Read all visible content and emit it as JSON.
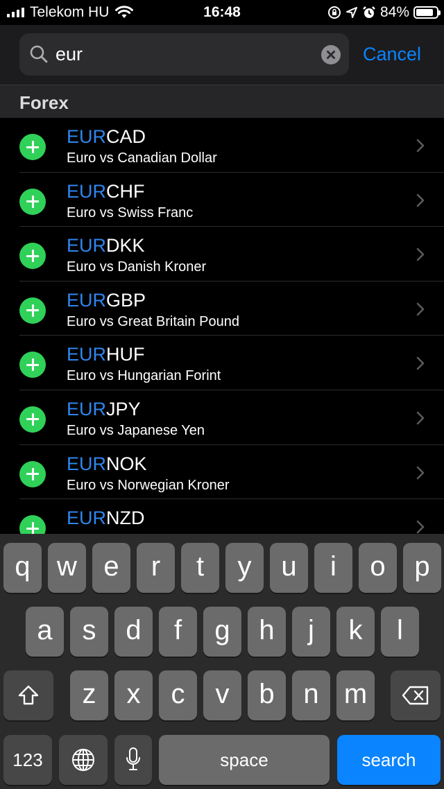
{
  "status_bar": {
    "carrier": "Telekom HU",
    "time": "16:48",
    "battery": "84%",
    "battery_level": 0.84,
    "icons": [
      "signal-icon",
      "wifi-icon",
      "orientation-lock-icon",
      "location-icon",
      "alarm-icon",
      "battery-icon"
    ]
  },
  "search": {
    "query": "eur",
    "cancel_label": "Cancel"
  },
  "section": {
    "title": "Forex"
  },
  "results": [
    {
      "match": "EUR",
      "rest": "CAD",
      "name": "Euro vs Canadian Dollar"
    },
    {
      "match": "EUR",
      "rest": "CHF",
      "name": "Euro vs Swiss Franc"
    },
    {
      "match": "EUR",
      "rest": "DKK",
      "name": "Euro vs Danish Kroner"
    },
    {
      "match": "EUR",
      "rest": "GBP",
      "name": "Euro vs Great Britain Pound"
    },
    {
      "match": "EUR",
      "rest": "HUF",
      "name": "Euro vs Hungarian Forint"
    },
    {
      "match": "EUR",
      "rest": "JPY",
      "name": "Euro vs Japanese Yen"
    },
    {
      "match": "EUR",
      "rest": "NOK",
      "name": "Euro vs Norwegian Kroner"
    },
    {
      "match": "EUR",
      "rest": "NZD",
      "name": ""
    }
  ],
  "keyboard": {
    "row1": [
      "q",
      "w",
      "e",
      "r",
      "t",
      "y",
      "u",
      "i",
      "o",
      "p"
    ],
    "row2": [
      "a",
      "s",
      "d",
      "f",
      "g",
      "h",
      "j",
      "k",
      "l"
    ],
    "row3": [
      "z",
      "x",
      "c",
      "v",
      "b",
      "n",
      "m"
    ],
    "numbers_label": "123",
    "space_label": "space",
    "search_label": "search"
  },
  "colors": {
    "accent": "#0a84ff",
    "match_highlight": "#2f86ee",
    "add_button": "#30d158"
  }
}
